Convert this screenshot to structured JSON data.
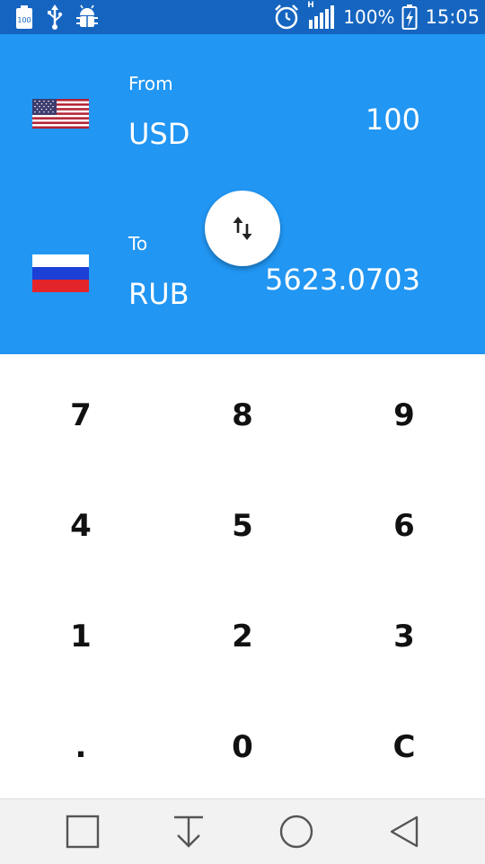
{
  "status_bar": {
    "battery_percent": "100%",
    "time": "15:05",
    "notification_badge": "100",
    "network_type": "H"
  },
  "converter": {
    "from": {
      "label": "From",
      "code": "USD",
      "amount": "100",
      "flag": "us-flag"
    },
    "to": {
      "label": "To",
      "code": "RUB",
      "amount": "5623.0703",
      "flag": "ru-flag"
    },
    "swap_icon": "swap-vertical-icon"
  },
  "keypad": {
    "rows": [
      [
        "7",
        "8",
        "9"
      ],
      [
        "4",
        "5",
        "6"
      ],
      [
        "1",
        "2",
        "3"
      ],
      [
        ".",
        "0",
        "C"
      ]
    ]
  },
  "nav_bar": {
    "icons": [
      "recents-square-icon",
      "notification-down-icon",
      "home-circle-icon",
      "back-triangle-icon"
    ]
  },
  "colors": {
    "status_bar": "#1565c0",
    "panel": "#2196f3",
    "keypad_bg": "#ffffff",
    "nav_bg": "#f2f2f2"
  }
}
